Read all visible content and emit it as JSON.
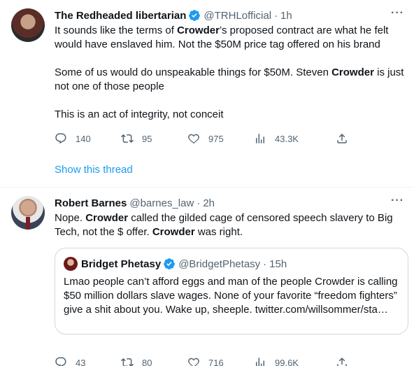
{
  "tweet1": {
    "name": "The Redheaded libertarian",
    "handle": "@TRHLofficial",
    "time": "1h",
    "text_parts": [
      [
        "It sounds like the terms of ",
        "Crowder",
        "’s proposed contract are what he felt would have enslaved him. Not the $50M price tag offered on his brand"
      ],
      [
        "Some of us would do unspeakable things for $50M. Steven ",
        "Crowder",
        " is just not one of those people"
      ],
      [
        "This is an act of integrity, not conceit"
      ]
    ],
    "p1a": "It sounds like the terms of ",
    "p1b": "Crowder",
    "p1c": "’s proposed contract are what he felt would have enslaved him. Not the $50M price tag offered on his brand",
    "p2a": "Some of us would do unspeakable things for $50M. Steven ",
    "p2b": "Crowder",
    "p2c": " is just not one of those people",
    "p3": "This is an act of integrity, not conceit",
    "replies": "140",
    "retweets": "95",
    "likes": "975",
    "views": "43.3K",
    "show_thread": "Show this thread"
  },
  "tweet2": {
    "name": "Robert Barnes",
    "handle": "@barnes_law",
    "time": "2h",
    "p1a": "Nope. ",
    "p1b": "Crowder",
    "p1c": " called the gilded cage of censored speech slavery to Big Tech, not the $ offer. ",
    "p1d": "Crowder",
    "p1e": " was right.",
    "quote": {
      "name": "Bridget Phetasy",
      "handle": "@BridgetPhetasy",
      "time": "15h",
      "text": "Lmao people can’t afford eggs and man of the people Crowder is calling $50 million dollars slave wages. None of your favorite “freedom fighters” give a shit about you. Wake up, sheeple.",
      "link": "twitter.com/willsommer/sta…"
    },
    "replies": "43",
    "retweets": "80",
    "likes": "716",
    "views": "99.6K"
  },
  "colors": {
    "accent": "#1d9bf0",
    "secondary_text": "#536471",
    "border": "#cfd9de"
  },
  "icons": [
    "more-icon",
    "verified-badge-icon",
    "reply-icon",
    "retweet-icon",
    "like-icon",
    "views-icon",
    "share-icon"
  ]
}
